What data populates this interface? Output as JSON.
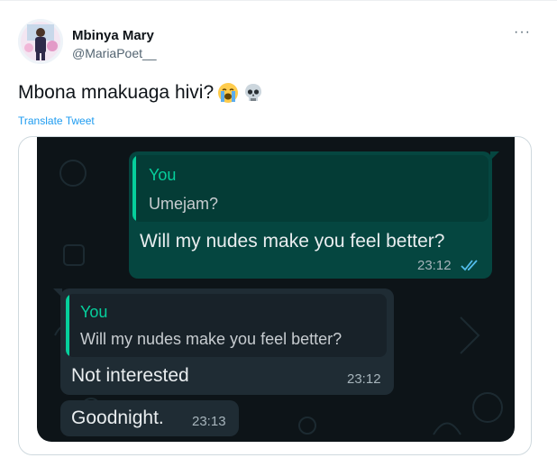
{
  "author": {
    "name": "Mbinya Mary",
    "handle": "@MariaPoet__"
  },
  "more_label": "···",
  "tweet": {
    "text": "Mbona mnakuaga hivi?",
    "emojis": [
      "loudly-crying-face-icon",
      "skull-icon"
    ],
    "translate_label": "Translate Tweet"
  },
  "chat": {
    "outgoing": {
      "quote_author": "You",
      "quote_text": "Umejam?",
      "message": "Will my nudes make you feel better?",
      "time": "23:12",
      "status_icon": "double-check-icon"
    },
    "incoming": [
      {
        "quote_author": "You",
        "quote_text": "Will my nudes make you feel better?",
        "message": "Not interested",
        "time": "23:12"
      },
      {
        "message": "Goodnight.",
        "time": "23:13"
      }
    ]
  },
  "colors": {
    "link": "#1d9bf0",
    "chat_background": "#0d1418",
    "outgoing_bubble": "#054640",
    "incoming_bubble": "#1f2c34",
    "quote_accent": "#06cf9c"
  }
}
